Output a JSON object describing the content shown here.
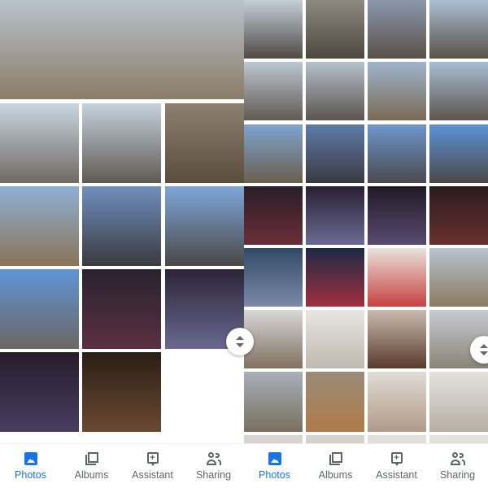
{
  "nav": [
    {
      "label": "Photos",
      "icon": "photos-icon",
      "active": true
    },
    {
      "label": "Albums",
      "icon": "albums-icon",
      "active": false
    },
    {
      "label": "Assistant",
      "icon": "assistant-icon",
      "active": false
    },
    {
      "label": "Sharing",
      "icon": "sharing-icon",
      "active": false
    }
  ],
  "colors": {
    "accent": "#1a73e8",
    "inactive": "#5f6368"
  },
  "left_tiles": [
    [
      "#b9c3cc",
      "#8a7c68"
    ],
    [
      "#c9d6e2",
      "#6f6a62"
    ],
    [
      "#c6d3de",
      "#5f5a52"
    ],
    [
      "#8d8070",
      "#5a4d3e"
    ],
    [
      "#8eb0d6",
      "#8a7456"
    ],
    [
      "#6f8fbf",
      "#3b3a40"
    ],
    [
      "#7ea6d8",
      "#4a4848"
    ],
    [
      "#5f95d8",
      "#6b6663"
    ],
    [
      "#2a2230",
      "#5a3040"
    ],
    [
      "#2c2538",
      "#6a6890"
    ],
    [
      "#251c2a",
      "#4a3c60"
    ],
    [
      "#2a1e16",
      "#6a4a30"
    ]
  ],
  "right_tiles": [
    [
      "#c5cfd8",
      "#4f4a44"
    ],
    [
      "#8f8a80",
      "#4c4840"
    ],
    [
      "#8a98ad",
      "#5b5048"
    ],
    [
      "#a9bed3",
      "#5a5248"
    ],
    [
      "#bcc7d2",
      "#605a52"
    ],
    [
      "#b6c1cc",
      "#5a554e"
    ],
    [
      "#9fb4cc",
      "#7a6a55"
    ],
    [
      "#a8bcd2",
      "#5d564e"
    ],
    [
      "#7fa3cf",
      "#6a5f50"
    ],
    [
      "#5f7aa8",
      "#3a3a42"
    ],
    [
      "#6e96cc",
      "#4a4a4e"
    ],
    [
      "#5d92d6",
      "#4a4848"
    ],
    [
      "#2a1e26",
      "#6a2e3a"
    ],
    [
      "#282034",
      "#6c6a92"
    ],
    [
      "#201a26",
      "#5a4a70"
    ],
    [
      "#2a1c1e",
      "#6a3030"
    ],
    [
      "#324a66",
      "#7a8aa8"
    ],
    [
      "#1e2a44",
      "#a03040"
    ],
    [
      "#e8e2dc",
      "#c84040"
    ],
    [
      "#b8c4d0",
      "#8a7a60"
    ],
    [
      "#d8d8d8",
      "#807060"
    ],
    [
      "#e8e6e2",
      "#c0b8ae"
    ],
    [
      "#c8bcb0",
      "#5a3a2a"
    ],
    [
      "#c8ccd2",
      "#8a8478"
    ],
    [
      "#a8b0b8",
      "#7a7060"
    ],
    [
      "#9a8a78",
      "#b07a48"
    ],
    [
      "#e0dcd6",
      "#b09a88"
    ],
    [
      "#e4e2de",
      "#b8aea4"
    ],
    [
      "#d8d4d0",
      "#cfcac4"
    ],
    [
      "#d6d2cc",
      "#cac4be"
    ],
    [
      "#e2e0dc",
      "#d0ccc6"
    ],
    [
      "#e4e2de",
      "#d4d0ca"
    ]
  ]
}
